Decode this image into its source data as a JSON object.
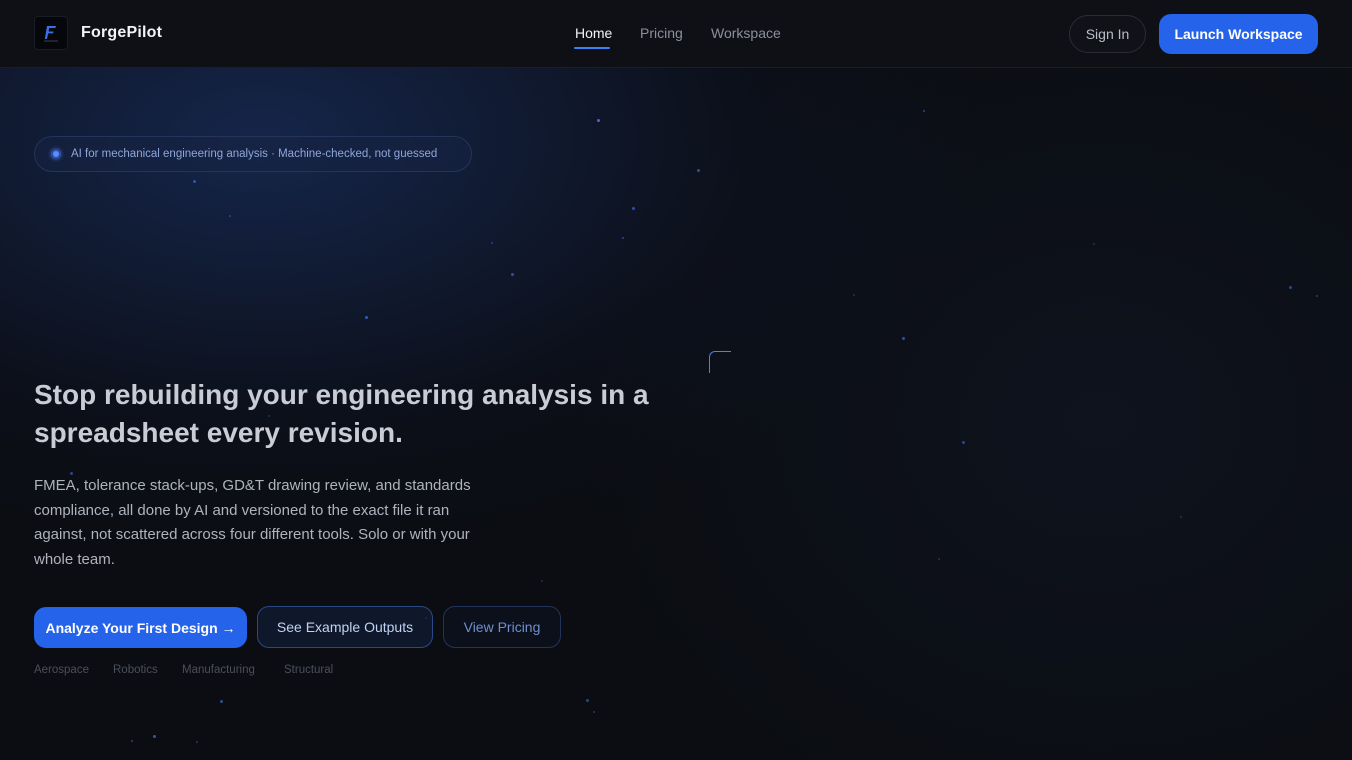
{
  "brand": {
    "name": "ForgePilot",
    "logo_icon": "forge-f-logo-icon"
  },
  "nav": {
    "items": [
      {
        "label": "Home",
        "active": true
      },
      {
        "label": "Pricing",
        "active": false
      },
      {
        "label": "Workspace",
        "active": false
      }
    ]
  },
  "header_actions": {
    "sign_in": "Sign In",
    "launch": "Launch Workspace"
  },
  "badge": {
    "text": "AI for mechanical engineering analysis · Machine-checked, not guessed"
  },
  "hero": {
    "title": "Stop rebuilding your engineering analysis in a spreadsheet every revision.",
    "description": "FMEA, tolerance stack-ups, GD&T drawing review, and standards compliance, all done by AI and versioned to the exact file it ran against, not scattered across four different tools. Solo or with your whole team."
  },
  "cta": {
    "primary": "Analyze Your First Design →",
    "secondary": "See Example Outputs",
    "tertiary": "View Pricing"
  },
  "industries": [
    "Aerospace",
    "Robotics",
    "Manufacturing",
    "Structural"
  ],
  "colors": {
    "accent": "#2563eb",
    "background": "#0b0d12",
    "badge_text": "#8fa6d9"
  }
}
